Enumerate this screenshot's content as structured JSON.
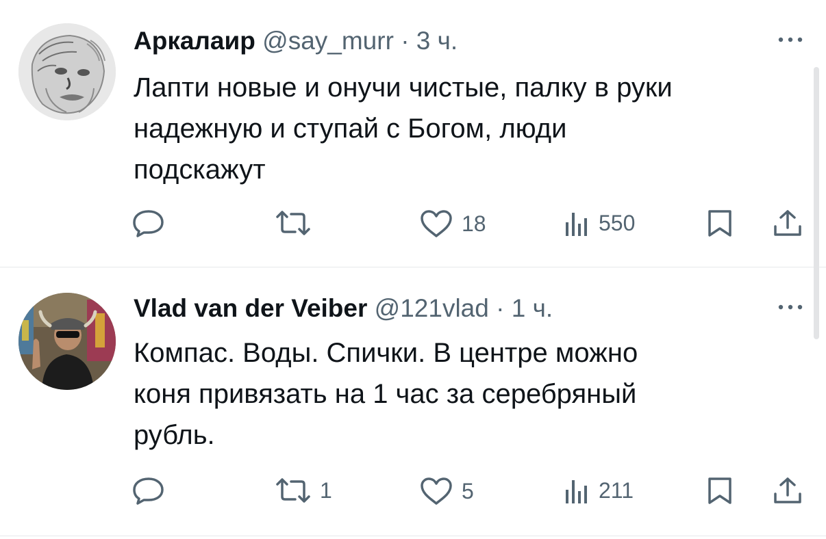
{
  "tweets": [
    {
      "author": "Аркалаир",
      "handle": "@say_murr",
      "separator": "·",
      "time": "3 ч.",
      "text": "Лапти новые и онучи чистые, палку в руки\nнадежную и ступай с Богом, люди\nподскажут",
      "replies": "",
      "retweets": "",
      "likes": "18",
      "views": "550"
    },
    {
      "author": "Vlad van der Veiber",
      "handle": "@121vlad",
      "separator": "·",
      "time": "1 ч.",
      "text": "Компас. Воды. Спички. В центре можно\nконя привязать на 1 час за серебряный\nрубль.",
      "replies": "",
      "retweets": "1",
      "likes": "5",
      "views": "211"
    }
  ],
  "icons": {
    "reply": "reply-icon",
    "retweet": "retweet-icon",
    "like": "heart-icon",
    "views": "views-icon",
    "bookmark": "bookmark-icon",
    "share": "share-icon",
    "more": "more-icon"
  },
  "colors": {
    "text": "#0f1419",
    "secondary": "#536471",
    "divider": "#e6e8eb"
  }
}
